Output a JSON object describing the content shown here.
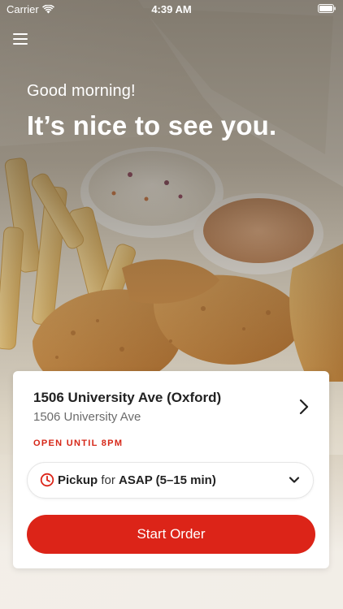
{
  "status_bar": {
    "carrier": "Carrier",
    "time": "4:39 AM"
  },
  "hero": {
    "greeting": "Good morning!",
    "headline": "It’s nice to see you."
  },
  "store": {
    "name": "1506 University Ave (Oxford)",
    "address": "1506 University Ave",
    "hours": "OPEN UNTIL 8PM"
  },
  "order_type": {
    "mode": "Pickup",
    "connector": "for",
    "time": "ASAP (5–15 min)"
  },
  "actions": {
    "start_order": "Start Order"
  },
  "icons": {
    "menu": "hamburger-menu-icon",
    "wifi": "wifi-icon",
    "battery": "battery-icon",
    "store_arrow": "chevron-right-icon",
    "clock": "clock-icon",
    "dropdown": "chevron-down-icon"
  },
  "colors": {
    "brand_red": "#dc2418",
    "hours_red": "#d62718",
    "card_bg": "#ffffff"
  }
}
